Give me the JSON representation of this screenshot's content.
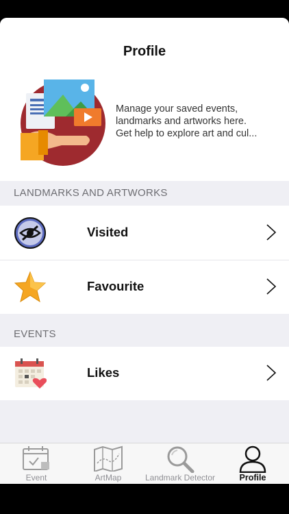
{
  "header": {
    "title": "Profile",
    "intro_lines": [
      "Manage your saved events,",
      "landmarks and artworks here.",
      "Get help to explore art and cul..."
    ]
  },
  "sections": [
    {
      "title": "LANDMARKS AND ARTWORKS",
      "items": [
        {
          "label": "Visited",
          "icon": "eye-slash-icon"
        },
        {
          "label": "Favourite",
          "icon": "star-icon"
        }
      ]
    },
    {
      "title": "EVENTS",
      "items": [
        {
          "label": "Likes",
          "icon": "calendar-heart-icon"
        }
      ]
    }
  ],
  "tabbar": {
    "tabs": [
      {
        "label": "Event",
        "icon": "calendar-icon"
      },
      {
        "label": "ArtMap",
        "icon": "map-icon"
      },
      {
        "label": "Landmark Detector",
        "icon": "magnifier-icon"
      },
      {
        "label": "Profile",
        "icon": "person-icon",
        "active": true
      }
    ]
  },
  "colors": {
    "hero_circle": "#9e2a2f",
    "accent_orange": "#f5a623",
    "tab_inactive": "#8e8e93"
  }
}
